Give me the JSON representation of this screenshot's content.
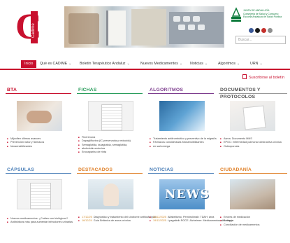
{
  "header": {
    "logo_text": "Cadime",
    "junta_text": [
      "JUNTA DE ANDALUCÍA",
      "Consejería de Salud y Consumo",
      "Escuela Andaluza de Salud Pública"
    ],
    "search_placeholder": "Buscar..."
  },
  "nav": {
    "items": [
      {
        "label": "Inicio",
        "active": true
      },
      {
        "label": "Qué es CADIME",
        "chevron": true
      },
      {
        "label": "Boletín Terapéutico Andaluz",
        "chevron": true
      },
      {
        "label": "Nuevos Medicamentos",
        "chevron": true
      },
      {
        "label": "Noticias",
        "chevron": true
      },
      {
        "label": "Algoritmos",
        "chevron": true
      },
      {
        "label": "URN",
        "chevron": true
      }
    ],
    "chevron": "⌄",
    "subscribe": "Suscribirse al boletín"
  },
  "social": {
    "colors": [
      "#3b5998",
      "#1a1a1a",
      "#c4302b",
      "#8f8f8f"
    ]
  },
  "sections": [
    {
      "title": "BTA",
      "color": "#c8102e",
      "items": [
        "Mijoxifen últimos avances",
        "Prevención natur y fármacos",
        "fotosensibilizantes"
      ]
    },
    {
      "title": "FICHAS",
      "color": "#2a9d5c",
      "items": [
        "Finerenona",
        "Dapagliflozina (IC preservada y reducida)",
        "Semaglutida, dulaglutida, semaglutida,",
        "abobotulinumtoxina",
        "Enoxaparina de rinta"
      ]
    },
    {
      "title": "ALGORITMOS",
      "color": "#7d3d8e",
      "items": [
        "Tratamiento antitrombótico y preventivo de la migraña",
        "Fármacos consideradas fotosensibilizantes",
        "en sarkomega"
      ]
    },
    {
      "title": "DOCUMENTOS Y PROTOCOLOS",
      "color": "#555555",
      "items": [
        "Asma. Documento MNS",
        "EPOC: enfermedad pulmonar obstructiva crónica",
        "Osteoporosis"
      ]
    },
    {
      "title": "CÁPSULAS",
      "color": "#4b7fb8",
      "items": [
        "Nuevos medicamentos: ¿Cuáles son biológicos?",
        "Antibióticos más para aumentar infecciones urinarias"
      ]
    },
    {
      "title": "DESTACADOS",
      "color": "#e0822b",
      "items": [
        {
          "date": "17/12/25",
          "text": "Diagnóstico y tratamiento del síndrome antifosfolípido"
        },
        {
          "date": "16/12/24",
          "text": "Guía Británica de asma crónica"
        }
      ]
    },
    {
      "title": "NOTICIAS",
      "color": "#4b7fb8",
      "items": [
        {
          "date": "22/12/2025",
          "text": "Alfabetismo, Pembrolimab: TDAH: área"
        },
        {
          "date": "19/12/2025",
          "text": "Lpagatinib RGCE: Alzheimer: Medicamentos alto riesgo"
        }
      ]
    },
    {
      "title": "CIUDADANÍA",
      "color": "#e0822b",
      "items": [
        "Errores de medicación",
        "Botiquín",
        "Conciliación de medicamentos"
      ]
    }
  ]
}
